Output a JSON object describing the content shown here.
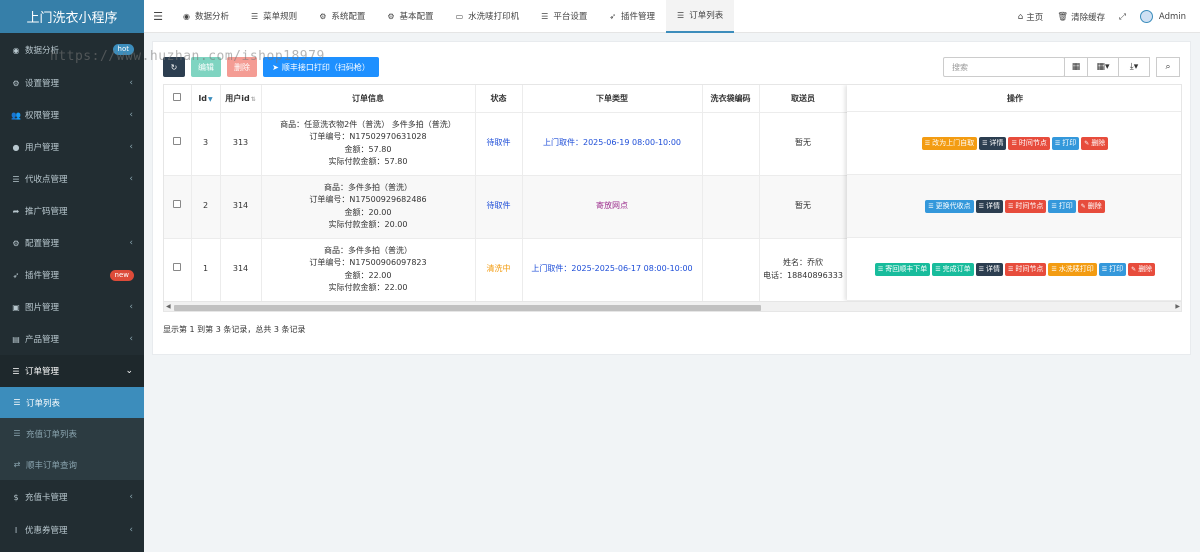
{
  "app": {
    "title": "上门洗衣小程序"
  },
  "sidebar": {
    "items": [
      {
        "label": "数据分析",
        "badge": "hot",
        "badge_color": "#3c8dbc"
      },
      {
        "label": "设置管理"
      },
      {
        "label": "权限管理"
      },
      {
        "label": "用户管理"
      },
      {
        "label": "代收点管理"
      },
      {
        "label": "推广码管理"
      },
      {
        "label": "配置管理"
      },
      {
        "label": "插件管理",
        "badge": "new",
        "badge_color": "#dd4b39"
      },
      {
        "label": "图片管理"
      },
      {
        "label": "产品管理"
      },
      {
        "label": "订单管理"
      },
      {
        "label": "订单列表"
      },
      {
        "label": "充值订单列表"
      },
      {
        "label": "顺丰订单查询"
      },
      {
        "label": "充值卡管理"
      },
      {
        "label": "优惠券管理"
      }
    ]
  },
  "topbar": {
    "tabs": [
      "数据分析",
      "菜单规则",
      "系统配置",
      "基本配置",
      "水洗唛打印机",
      "平台设置",
      "插件管理",
      "订单列表"
    ],
    "home": "主页",
    "clear_cache": "清除缓存",
    "user": "Admin"
  },
  "toolbar": {
    "edit": "编辑",
    "delete": "删除",
    "print": "顺丰接口打印（扫码枪）",
    "search_placeholder": "搜索"
  },
  "table": {
    "headers": {
      "id": "Id",
      "user_id": "用户id",
      "order_info": "订单信息",
      "status": "状态",
      "order_type": "下单类型",
      "bag_code": "洗衣袋编码",
      "courier": "取送员",
      "ops": "操作"
    },
    "rows": [
      {
        "id": "3",
        "user_id": "313",
        "info": [
          "商品：任意洗衣物2件（普洗） 多件多拍（普洗）",
          "订单编号：N17502970631028",
          "金额：57.80",
          "实际付款金额：57.80"
        ],
        "status": "待取件",
        "order_type": "上门取件：2025-06-19 08:00-10:00",
        "bag_code": "",
        "courier": [
          "暂无"
        ],
        "ops": [
          {
            "label": "改为上门自取",
            "color": "#f39c12"
          },
          {
            "label": "详情",
            "color": "#2c3e50"
          },
          {
            "label": "时间节点",
            "color": "#e74c3c"
          },
          {
            "label": "打印",
            "color": "#3498db"
          },
          {
            "label": "删除",
            "color": "#e74c3c"
          }
        ]
      },
      {
        "id": "2",
        "user_id": "314",
        "info": [
          "商品：多件多拍（普洗）",
          "订单编号：N17500929682486",
          "金额：20.00",
          "实际付款金额：20.00"
        ],
        "status": "待取件",
        "order_type": "寄放网点",
        "bag_code": "",
        "courier": [
          "暂无"
        ],
        "ops": [
          {
            "label": "更换代收点",
            "color": "#3498db"
          },
          {
            "label": "详情",
            "color": "#2c3e50"
          },
          {
            "label": "时间节点",
            "color": "#e74c3c"
          },
          {
            "label": "打印",
            "color": "#3498db"
          },
          {
            "label": "删除",
            "color": "#e74c3c"
          }
        ]
      },
      {
        "id": "1",
        "user_id": "314",
        "info": [
          "商品：多件多拍（普洗）",
          "订单编号：N17500906097823",
          "金额：22.00",
          "实际付款金额：22.00"
        ],
        "status": "清洗中",
        "order_type": "上门取件：2025-2025-06-17 08:00-10:00",
        "bag_code": "",
        "courier": [
          "姓名：乔欣",
          "电话：18840896333"
        ],
        "ops": [
          {
            "label": "寄回顺丰下单",
            "color": "#18bc9c"
          },
          {
            "label": "完成订单",
            "color": "#18bc9c"
          },
          {
            "label": "详情",
            "color": "#2c3e50"
          },
          {
            "label": "时间节点",
            "color": "#e74c3c"
          },
          {
            "label": "水洗唛打印",
            "color": "#f39c12"
          },
          {
            "label": "打印",
            "color": "#3498db"
          },
          {
            "label": "删除",
            "color": "#e74c3c"
          }
        ]
      }
    ]
  },
  "pagination": {
    "summary": "显示第 1 到第 3 条记录，总共 3 条记录"
  },
  "watermark": "https://www.huzhan.com/ishop18979"
}
